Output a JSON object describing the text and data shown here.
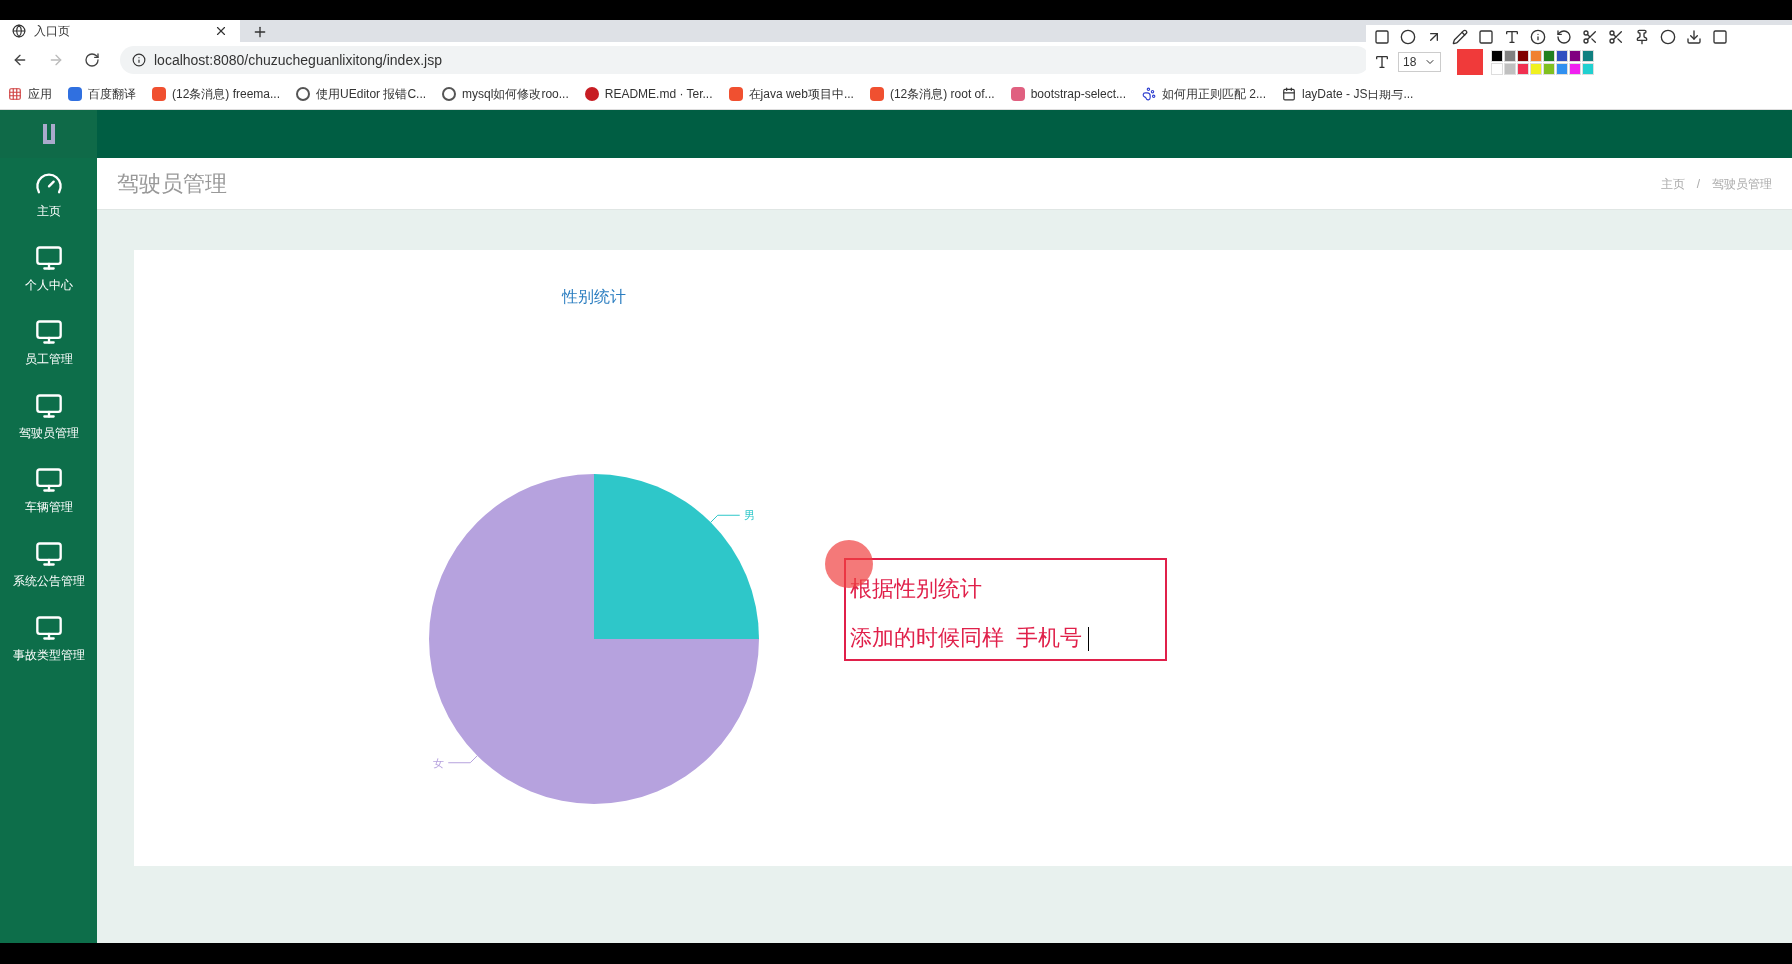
{
  "browser": {
    "tab_title": "入口页",
    "url": "localhost:8080/chuzucheguanlixitong/index.jsp",
    "bookmarks": [
      {
        "label": "应用",
        "kind": "apps"
      },
      {
        "label": "百度翻译",
        "kind": "blue"
      },
      {
        "label": "(12条消息) freema...",
        "kind": "csdn"
      },
      {
        "label": "使用UEditor 报错C...",
        "kind": "gh"
      },
      {
        "label": "mysql如何修改roo...",
        "kind": "gh"
      },
      {
        "label": "README.md · Ter...",
        "kind": "gitee"
      },
      {
        "label": "在java web项目中...",
        "kind": "csdn"
      },
      {
        "label": "(12条消息) root of...",
        "kind": "csdn"
      },
      {
        "label": "bootstrap-select...",
        "kind": "pink"
      },
      {
        "label": "如何用正则匹配  2...",
        "kind": "paw"
      },
      {
        "label": "layDate - JS日期与...",
        "kind": "cal"
      }
    ]
  },
  "capture_toolbar": {
    "font_size": "18"
  },
  "sidebar": {
    "items": [
      {
        "label": "主页",
        "kind": "dashboard",
        "selected": false
      },
      {
        "label": "个人中心",
        "kind": "monitor",
        "selected": false
      },
      {
        "label": "员工管理",
        "kind": "monitor",
        "selected": false
      },
      {
        "label": "驾驶员管理",
        "kind": "monitor",
        "selected": false
      },
      {
        "label": "车辆管理",
        "kind": "monitor",
        "selected": false
      },
      {
        "label": "系统公告管理",
        "kind": "monitor",
        "selected": false
      },
      {
        "label": "事故类型管理",
        "kind": "monitor",
        "selected": false
      }
    ]
  },
  "page": {
    "title": "驾驶员管理",
    "breadcrumb": [
      "主页",
      "驾驶员管理"
    ],
    "breadcrumb_separator": "/"
  },
  "chart": {
    "chart_data": {
      "type": "pie",
      "title": "性别统计",
      "categories": [
        "男",
        "女"
      ],
      "series": [
        {
          "values": [
            25,
            75
          ]
        }
      ],
      "colors": [
        "#2ec7c9",
        "#b6a2de"
      ]
    }
  },
  "annotation": {
    "lines": [
      "根据性别统计",
      "添加的时候同样  手机号"
    ]
  }
}
